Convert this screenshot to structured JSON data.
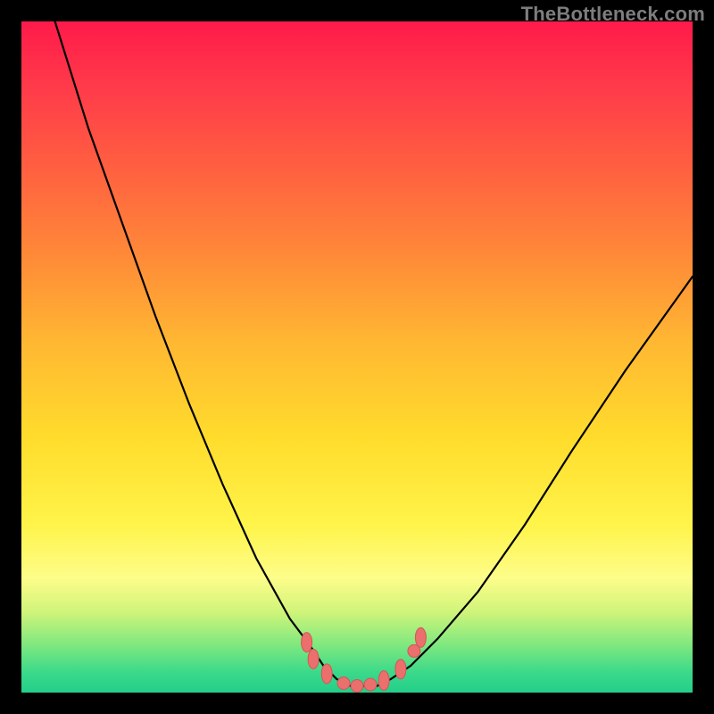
{
  "watermark": "TheBottleneck.com",
  "colors": {
    "background": "#000000",
    "curve": "#000000",
    "marker_fill": "#eb6f6c",
    "marker_stroke": "#d35656",
    "gradient_top": "#ff1a4a",
    "gradient_bottom": "#23cf8a"
  },
  "chart_data": {
    "type": "line",
    "title": "",
    "xlabel": "",
    "ylabel": "",
    "xlim": [
      0,
      100
    ],
    "ylim": [
      0,
      100
    ],
    "grid": false,
    "legend": false,
    "series": [
      {
        "name": "bottleneck-curve",
        "x": [
          5,
          10,
          15,
          20,
          25,
          30,
          35,
          40,
          43,
          45,
          47,
          49,
          51,
          53,
          55,
          58,
          62,
          68,
          75,
          82,
          90,
          100
        ],
        "y": [
          100,
          84,
          70,
          56,
          43,
          31,
          20,
          11,
          7,
          4,
          2,
          1,
          1,
          1,
          2,
          4,
          8,
          15,
          25,
          36,
          48,
          62
        ]
      }
    ],
    "markers": [
      {
        "x": 42.5,
        "y": 7.5,
        "shape": "oval"
      },
      {
        "x": 43.5,
        "y": 5.0,
        "shape": "oval"
      },
      {
        "x": 45.5,
        "y": 2.8,
        "shape": "oval"
      },
      {
        "x": 48.0,
        "y": 1.4,
        "shape": "round"
      },
      {
        "x": 50.0,
        "y": 1.0,
        "shape": "round"
      },
      {
        "x": 52.0,
        "y": 1.2,
        "shape": "round"
      },
      {
        "x": 54.0,
        "y": 1.8,
        "shape": "oval"
      },
      {
        "x": 56.5,
        "y": 3.5,
        "shape": "oval"
      },
      {
        "x": 58.5,
        "y": 6.2,
        "shape": "round"
      },
      {
        "x": 59.5,
        "y": 8.2,
        "shape": "oval"
      }
    ]
  }
}
